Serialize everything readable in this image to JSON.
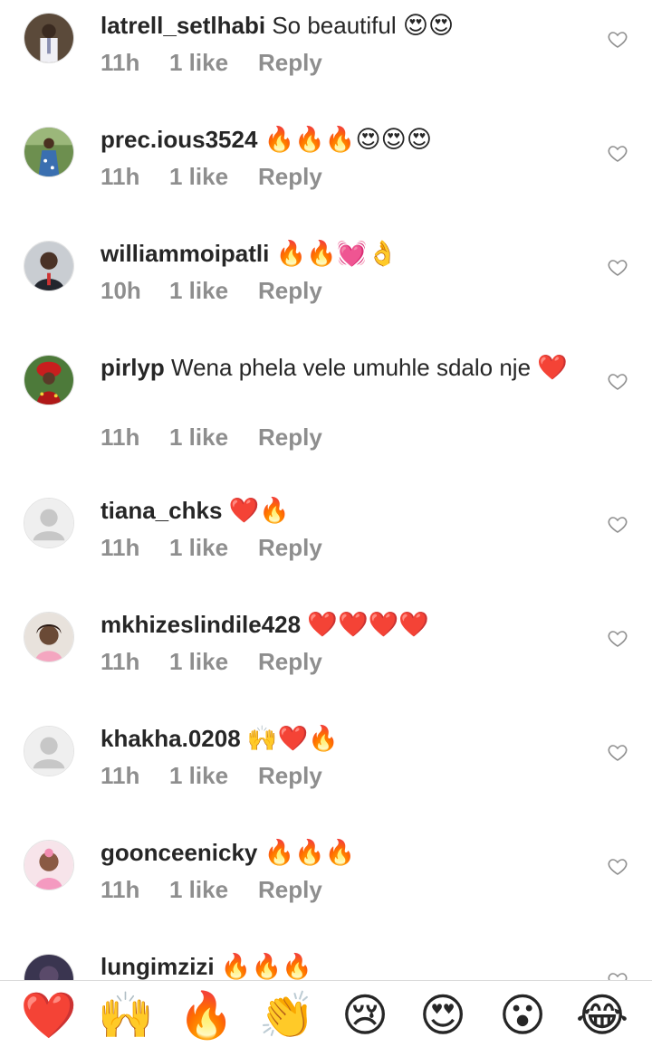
{
  "comments": [
    {
      "username": "latrell_setlhabi",
      "text": "So beautiful",
      "emoji": "😍😍",
      "time": "11h",
      "likes": "1 like",
      "reply": "Reply",
      "avatar": "photo-man-suit"
    },
    {
      "username": "prec.ious3524",
      "text": "",
      "emoji": "🔥🔥🔥😍😍😍",
      "time": "11h",
      "likes": "1 like",
      "reply": "Reply",
      "avatar": "photo-woman-dress"
    },
    {
      "username": "williammoipatli",
      "text": "",
      "emoji": "🔥🔥💓👌",
      "time": "10h",
      "likes": "1 like",
      "reply": "Reply",
      "avatar": "photo-man-portrait"
    },
    {
      "username": "pirlyp",
      "text": "Wena phela vele umuhle sdalo nje",
      "emoji": "❤️",
      "time": "11h",
      "likes": "1 like",
      "reply": "Reply",
      "avatar": "photo-red-hat"
    },
    {
      "username": "tiana_chks",
      "text": "",
      "emoji": "❤️🔥",
      "time": "11h",
      "likes": "1 like",
      "reply": "Reply",
      "avatar": "default-avatar"
    },
    {
      "username": "mkhizeslindile428",
      "text": "",
      "emoji": "❤️❤️❤️❤️",
      "time": "11h",
      "likes": "1 like",
      "reply": "Reply",
      "avatar": "photo-woman-portrait"
    },
    {
      "username": "khakha.0208",
      "text": "",
      "emoji": "🙌❤️🔥",
      "time": "11h",
      "likes": "1 like",
      "reply": "Reply",
      "avatar": "default-avatar"
    },
    {
      "username": "goonceenicky",
      "text": "",
      "emoji": "🔥🔥🔥",
      "time": "11h",
      "likes": "1 like",
      "reply": "Reply",
      "avatar": "photo-baby-pink"
    },
    {
      "username": "lungimzizi",
      "text": "",
      "emoji": "🔥🔥🔥",
      "time": "",
      "likes": "",
      "reply": "",
      "avatar": "photo-dark"
    }
  ],
  "quick_reactions": [
    "❤️",
    "🙌",
    "🔥",
    "👏",
    "😢",
    "😍",
    "😮",
    "😂"
  ],
  "colors": {
    "text": "#262626",
    "meta": "#8e8e8e",
    "divider": "#dbdbdb"
  }
}
